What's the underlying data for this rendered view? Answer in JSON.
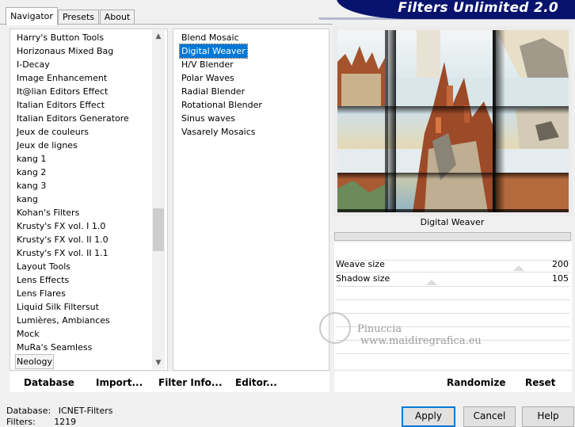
{
  "tabs": [
    {
      "label": "Navigator",
      "active": true
    },
    {
      "label": "Presets",
      "active": false
    },
    {
      "label": "About",
      "active": false
    }
  ],
  "banner": {
    "title": "Filters Unlimited 2.0"
  },
  "categories": [
    "Harry's Button Tools",
    "Horizonaus Mixed Bag",
    "I-Decay",
    "Image Enhancement",
    "It@lian Editors Effect",
    "Italian Editors Effect",
    "Italian Editors Generatore",
    "Jeux de couleurs",
    "Jeux de lignes",
    "kang 1",
    "kang 2",
    "kang 3",
    "kang",
    "Kohan's Filters",
    "Krusty's FX vol. I 1.0",
    "Krusty's FX vol. II 1.0",
    "Krusty's FX vol. II 1.1",
    "Layout Tools",
    "Lens Effects",
    "Lens Flares",
    "Liquid Silk Filtersut",
    "Lumières, Ambiances",
    "Mock",
    "MuRa's Seamless",
    "Neology"
  ],
  "selected_category": "Neology",
  "filters": [
    "Blend Mosaic",
    "Digital Weaver",
    "H/V Blender",
    "Polar Waves",
    "Radial Blender",
    "Rotational Blender",
    "Sinus waves",
    "Vasarely Mosaics"
  ],
  "selected_filter": "Digital Weaver",
  "preview": {
    "caption": "Digital Weaver"
  },
  "params": [
    {
      "label": "Weave size",
      "value": "200",
      "slider_fraction": 0.78
    },
    {
      "label": "Shadow size",
      "value": "105",
      "slider_fraction": 0.41
    }
  ],
  "buttons": {
    "database": "Database",
    "import": "Import...",
    "filter_info": "Filter Info...",
    "editor": "Editor...",
    "randomize": "Randomize",
    "reset": "Reset",
    "apply": "Apply",
    "cancel": "Cancel",
    "help": "Help"
  },
  "status": {
    "database_label": "Database:",
    "database_value": "ICNET-Filters",
    "filters_label": "Filters:",
    "filters_value": "1219"
  },
  "watermark": {
    "line1": "Pinuccia",
    "line2": "www.maidiregrafica.eu"
  },
  "colors": {
    "banner": "#08136d",
    "selection": "#0078d7"
  }
}
